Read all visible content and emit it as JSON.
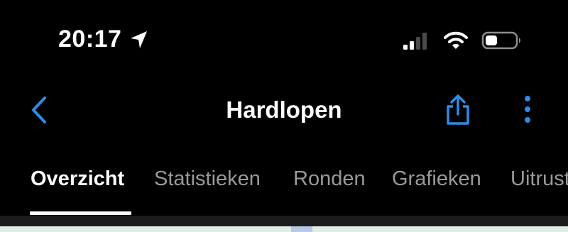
{
  "status_bar": {
    "time": "20:17",
    "location_icon": "location-arrow-icon",
    "signal_icon": "cellular-signal-icon",
    "wifi_icon": "wifi-icon",
    "battery_icon": "battery-low-icon"
  },
  "nav": {
    "back_icon": "chevron-left-icon",
    "title": "Hardlopen",
    "share_icon": "share-icon",
    "more_icon": "more-vertical-icon"
  },
  "tabs": [
    {
      "label": "Overzicht",
      "active": true
    },
    {
      "label": "Statistieken",
      "active": false
    },
    {
      "label": "Ronden",
      "active": false
    },
    {
      "label": "Grafieken",
      "active": false
    },
    {
      "label": "Uitrusting",
      "active": false
    }
  ],
  "colors": {
    "background": "#000000",
    "accent": "#2f8be6",
    "active_tab": "#ffffff",
    "inactive_tab": "#9a9a9a",
    "divider": "#1c1c1e"
  }
}
